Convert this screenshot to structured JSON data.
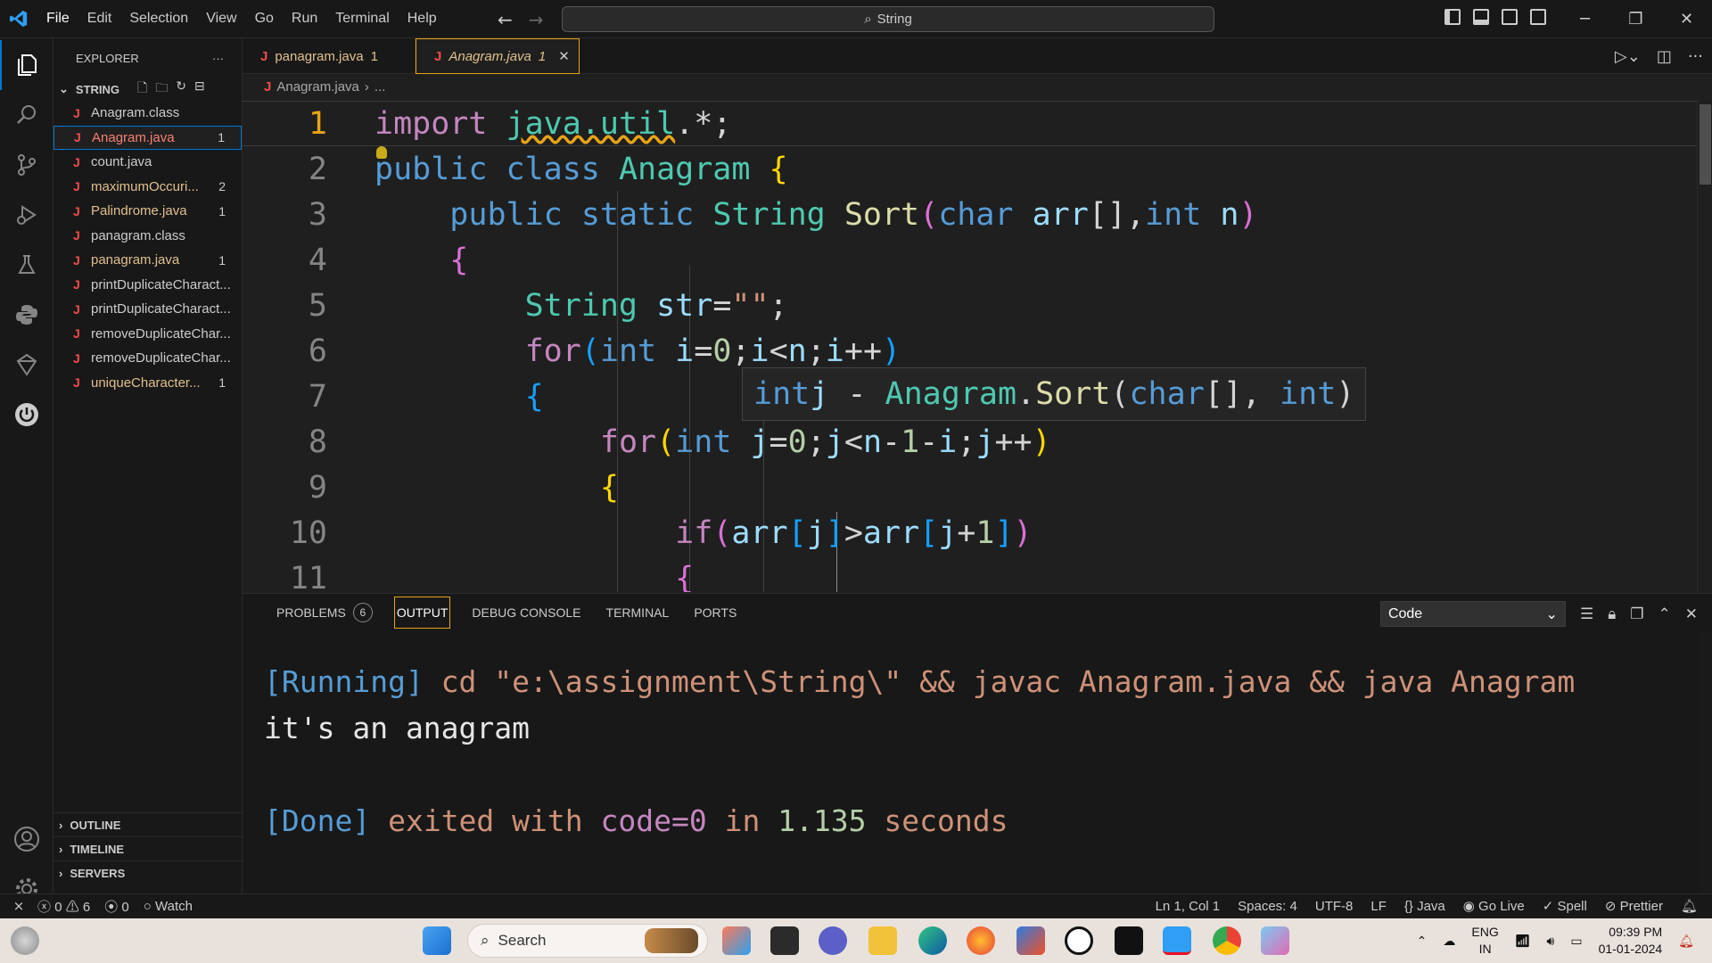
{
  "titlebar": {
    "menu": [
      "File",
      "Edit",
      "Selection",
      "View",
      "Go",
      "Run",
      "Terminal",
      "Help"
    ],
    "command_center": "String",
    "window_controls": [
      "minimize-icon",
      "restore-icon",
      "close-icon"
    ]
  },
  "activity_bar": [
    "explorer-icon",
    "search-icon",
    "source-control-icon",
    "run-debug-icon",
    "testing-icon",
    "python-icon",
    "remote-explorer-icon",
    "power-icon",
    "account-icon",
    "settings-gear-icon"
  ],
  "sidebar": {
    "title": "EXPLORER",
    "more": "···",
    "folder": "STRING",
    "files": [
      {
        "name": "Anagram.class",
        "count": ""
      },
      {
        "name": "Anagram.java",
        "count": "1"
      },
      {
        "name": "count.java",
        "count": ""
      },
      {
        "name": "maximumOccuri...",
        "count": "2"
      },
      {
        "name": "Palindrome.java",
        "count": "1"
      },
      {
        "name": "panagram.class",
        "count": ""
      },
      {
        "name": "panagram.java",
        "count": "1"
      },
      {
        "name": "printDuplicateCharact...",
        "count": ""
      },
      {
        "name": "printDuplicateCharact...",
        "count": ""
      },
      {
        "name": "removeDuplicateChar...",
        "count": ""
      },
      {
        "name": "removeDuplicateChar...",
        "count": ""
      },
      {
        "name": "uniqueCharacter...",
        "count": "1"
      }
    ],
    "sections": [
      "OUTLINE",
      "TIMELINE",
      "SERVERS"
    ]
  },
  "tabs": [
    {
      "label": "panagram.java",
      "count": "1"
    },
    {
      "label": "Anagram.java",
      "count": "1"
    }
  ],
  "breadcrumb": {
    "file": "Anagram.java",
    "rest": "..."
  },
  "editor": {
    "line_numbers": [
      "1",
      "2",
      "3",
      "4",
      "5",
      "6",
      "7",
      "8",
      "9",
      "10",
      "11"
    ],
    "hover": {
      "kw": "int",
      "var": "j",
      "sep": " - ",
      "cls": "Anagram",
      "dot": ".",
      "fn": "Sort",
      "open": "(",
      "t1": "char",
      "mid": "[], ",
      "t2": "int",
      "close": ")"
    }
  },
  "panel": {
    "tabs": [
      {
        "label": "PROBLEMS",
        "badge": "6"
      },
      {
        "label": "OUTPUT"
      },
      {
        "label": "DEBUG CONSOLE"
      },
      {
        "label": "TERMINAL"
      },
      {
        "label": "PORTS"
      }
    ],
    "channel": "Code",
    "output": {
      "running_tag": "[Running]",
      "command": " cd \"e:\\assignment\\String\\\" && javac Anagram.java && java Anagram",
      "result": "it's an anagram",
      "done_tag": "[Done]",
      "exited": " exited with ",
      "code": "code=0",
      "in": " in ",
      "time": "1.135",
      "seconds": " seconds"
    }
  },
  "statusbar": {
    "errors": "0",
    "warnings": "6",
    "ports": "0",
    "watch": "Watch",
    "position": "Ln 1, Col 1",
    "spaces": "Spaces: 4",
    "encoding": "UTF-8",
    "eol": "LF",
    "language": "Java",
    "golive": "Go Live",
    "spell": "Spell",
    "prettier": "Prettier"
  },
  "taskbar": {
    "search_placeholder": "Search",
    "lang_top": "ENG",
    "lang_bottom": "IN",
    "time": "09:39 PM",
    "date": "01-01-2024"
  }
}
